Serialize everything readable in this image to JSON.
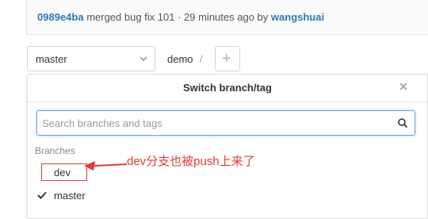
{
  "commit": {
    "sha": "0989e4ba",
    "message": "merged bug fix 101 · 29 minutes ago by",
    "author": "wangshuai"
  },
  "toolbar": {
    "branch_label": "master",
    "breadcrumb": "demo",
    "breadcrumb_sep": "/",
    "add_label": "+"
  },
  "dropdown": {
    "title": "Switch branch/tag",
    "search_placeholder": "Search branches and tags",
    "section_label": "Branches",
    "branches": [
      {
        "name": "dev",
        "selected": false
      },
      {
        "name": "master",
        "selected": true
      }
    ]
  },
  "annotation": {
    "text": "dev分支也被push上来了",
    "color": "#e53935"
  },
  "colors": {
    "link": "#2e77b8",
    "focus": "#6aa9d9"
  }
}
